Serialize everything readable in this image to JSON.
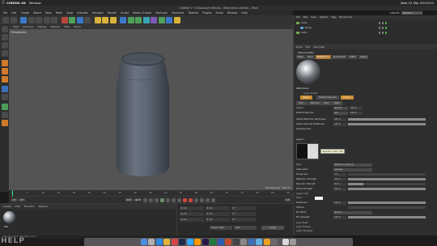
{
  "os_menu": {
    "app": "CINEMA 4D",
    "window": "Window",
    "clock": "Wed 22 Mar  09:50:53"
  },
  "title": "Untitled 1 * (Classroom Version - Restricted License) - Main",
  "c4d_menu": [
    "File",
    "Edit",
    "Create",
    "Select",
    "Tools",
    "Mesh",
    "Snap",
    "Animate",
    "Simulate",
    "Render",
    "Sculpt",
    "Motion Tracker",
    "MoGraph",
    "Character",
    "Pipeline",
    "Plugins",
    "Script",
    "Window",
    "Help"
  ],
  "layout": {
    "label": "Layout:",
    "value": "Startup"
  },
  "viewport": {
    "menu": [
      "View",
      "Cameras",
      "Display",
      "Options",
      "Filter",
      "Panel"
    ],
    "label": "Perspective",
    "grid": "Grid Spacing : 100 cm"
  },
  "timeline": {
    "ticks": [
      "0",
      "5",
      "10",
      "15",
      "20",
      "25",
      "30",
      "35",
      "40",
      "45",
      "50",
      "55",
      "60",
      "65",
      "70",
      "75",
      "80",
      "85",
      "90"
    ],
    "current": "0 F",
    "start": "0 F",
    "end": "90 F",
    "end2": "90 F",
    "right_frame": "0 F"
  },
  "material_manager": {
    "menu": [
      "Create",
      "Edit",
      "Function",
      "Texture"
    ],
    "material_name": "Mat"
  },
  "coordinates": {
    "rows": [
      [
        "0 cm",
        "0 cm",
        "0 °"
      ],
      [
        "0 cm",
        "0 cm",
        "0 °"
      ],
      [
        "0 cm",
        "0 cm",
        "0 °"
      ]
    ],
    "mode": "Object (Rel)",
    "size_mode": "Size",
    "apply": "Apply"
  },
  "status": "Azimuth: 145.4°, Elevation: 10.1°",
  "object_manager": {
    "menu": [
      "File",
      "Edit",
      "View",
      "Objects",
      "Tags",
      "Bookmarks"
    ],
    "objects": [
      {
        "name": "Lathe"
      },
      {
        "name": "Spline"
      },
      {
        "name": "Lathe"
      }
    ]
  },
  "attribute_manager": {
    "menu": [
      "Mode",
      "Edit",
      "User Data"
    ],
    "header": "Material [Mat]",
    "tabs": [
      "Basic",
      "Color",
      "Reflectance",
      "Illumination",
      "Editor",
      "Assign"
    ],
    "section_reflectance": "Reflectance",
    "layer_label": "Layer Global",
    "layer_tabs": [
      "Layers",
      "Default Specular",
      "Layer 1"
    ],
    "layer_buttons": [
      "Add...",
      "Remove",
      "Copy",
      "Paste"
    ],
    "layers": [
      {
        "name": "Layer 1",
        "mode": "Normal",
        "value": "100 %"
      },
      {
        "name": "Default Specular",
        "mode": "Add",
        "value": "100 %"
      }
    ],
    "global_rows": [
      {
        "label": "Global Reflection Brightness",
        "value": "100 %",
        "fill": 1.0
      },
      {
        "label": "Global Specular Brightness",
        "value": "100 %",
        "fill": 1.0
      },
      {
        "label": "Separate Pass",
        "value": ""
      }
    ],
    "layer1_title": "Layer 1",
    "tooltip": "Resolution 300 x 300",
    "params": [
      {
        "label": "Type",
        "dd": "Reflection (Legacy)"
      },
      {
        "label": "Attenuation",
        "dd": "Average"
      },
      {
        "label": "Roughness",
        "value": "0 %",
        "fill": 0.0
      },
      {
        "label": "Reflection Strength",
        "value": "100 %",
        "fill": 1.0
      },
      {
        "label": "Specular Strength",
        "value": "20 %",
        "fill": 0.2
      },
      {
        "label": "Bump Strength",
        "value": "100 %",
        "fill": 1.0
      }
    ],
    "layer_color": "Layer Color",
    "color_rows": [
      {
        "label": "Color",
        "value": ""
      },
      {
        "label": "Brightness",
        "value": "100 %",
        "fill": 1.0
      },
      {
        "label": "Texture",
        "value": ""
      },
      {
        "label": "Mix Mode",
        "dd": "Normal"
      },
      {
        "label": "Mix Strength",
        "value": "100 %",
        "fill": 1.0
      }
    ],
    "collapsed": [
      "Layer Mask",
      "Layer Fresnel",
      "Layer Sampling"
    ]
  },
  "dock_label": "HELP",
  "colors": {
    "accent": "#c98b32",
    "viewport_bg": "#545454",
    "can": "#5b6470",
    "timeline_cursor": "#1fe07a"
  }
}
